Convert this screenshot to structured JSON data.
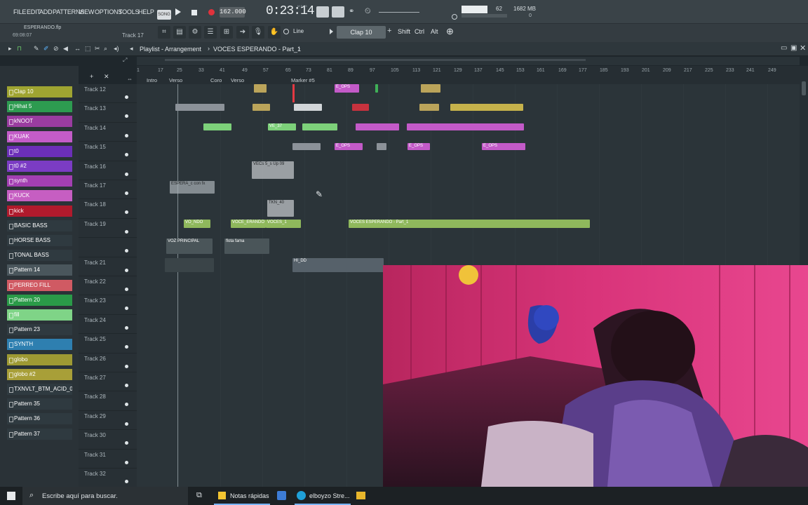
{
  "menu": [
    "FILE",
    "EDIT",
    "ADD",
    "PATTERNS",
    "VIEW",
    "OPTIONS",
    "TOOLS",
    "HELP"
  ],
  "file": {
    "name": "ESPERANDO.flp",
    "time": "69:08:07"
  },
  "transport": {
    "tempo": "162.000",
    "time": "0:23:14",
    "time_unit": "M:S:CS",
    "cpu": "62",
    "memory": "1682 MB",
    "status_values": [
      "0",
      "0"
    ]
  },
  "hint": {
    "track": "Track 17"
  },
  "toolbar": {
    "snap": "Line",
    "pattern": "Clap 10",
    "mod_keys": [
      "Shift",
      "Ctrl",
      "Alt"
    ]
  },
  "playlist": {
    "title": "Playlist - Arrangement",
    "pattern": "VOCES ESPERANDO - Part_1"
  },
  "ruler": {
    "ticks": [
      "1",
      "17",
      "25",
      "33",
      "41",
      "49",
      "57",
      "65",
      "73",
      "81",
      "89",
      "97",
      "105",
      "113",
      "121",
      "129",
      "137",
      "145",
      "153",
      "161",
      "169",
      "177",
      "185",
      "193",
      "201",
      "209",
      "217",
      "225",
      "233",
      "241",
      "249"
    ],
    "markers": [
      "Intro",
      "Verso",
      "Coro",
      "Verso",
      "Marker #5"
    ]
  },
  "channels": [
    {
      "name": "Clap 10",
      "color": "#9fa431"
    },
    {
      "name": "Hihat 5",
      "color": "#2d9b50"
    },
    {
      "name": "kNOOT",
      "color": "#9a3ca0"
    },
    {
      "name": "KUAK",
      "color": "#c35cc8"
    },
    {
      "name": "t0",
      "color": "#6b2fb8"
    },
    {
      "name": "t0 #2",
      "color": "#7b3cc4"
    },
    {
      "name": "synth",
      "color": "#a33fb2"
    },
    {
      "name": "KUCK",
      "color": "#c65ec2"
    },
    {
      "name": "kick",
      "color": "#b01a2c"
    },
    {
      "name": "BASIC BASS",
      "color": "#2f3a40"
    },
    {
      "name": "HORSE BASS",
      "color": "#2f3a40"
    },
    {
      "name": "TONAL BASS",
      "color": "#2f3a40"
    },
    {
      "name": "Pattern 14",
      "color": "#4a565c"
    },
    {
      "name": "PERREO FILL",
      "color": "#d05a63"
    },
    {
      "name": "Pattern 20",
      "color": "#2a9a48"
    },
    {
      "name": "fill",
      "color": "#7fd487"
    },
    {
      "name": "Pattern 23",
      "color": "#2f3a40"
    },
    {
      "name": "SYNTH",
      "color": "#2e7fb0"
    },
    {
      "name": "globo",
      "color": "#9e9a33"
    },
    {
      "name": "globo #2",
      "color": "#a89f38"
    },
    {
      "name": "TXNVLT_BTM_ACID_07(E)",
      "color": "#2f3a40"
    },
    {
      "name": "Pattern 35",
      "color": "#2f3a40"
    },
    {
      "name": "Pattern 36",
      "color": "#2f3a40"
    },
    {
      "name": "Pattern 37",
      "color": "#2f3a40"
    }
  ],
  "tracks": [
    "Track 12",
    "Track 13",
    "Track 14",
    "Track 15",
    "Track 16",
    "Track 17",
    "Track 18",
    "Track 19",
    "",
    "Track 21",
    "Track 22",
    "Track 23",
    "Track 24",
    "Track 25",
    "Track 26",
    "Track 27",
    "Track 28",
    "Track 29",
    "Track 30",
    "Track 31",
    "Track 32"
  ],
  "clip_labels": {
    "t12": "E_OPS",
    "t14": "VE_37",
    "t15a": "E_OPS",
    "t15b": "E_OPS",
    "t15c": "E_OPS",
    "t16": "VECs 5_s Up 09",
    "t17": "ESPERA_c con fx",
    "t18": "TKN_40",
    "t19a": "VO_NDO",
    "t19b": "VOCE_ERANDO",
    "t19c": "VOCES_1",
    "t19d": "VOCES ESPERANDO - Part_1",
    "t20a": "VOZ PRINCIPAL",
    "t20b": "flota fama",
    "t21": "HI_DD"
  },
  "taskbar": {
    "search_placeholder": "Escribe aquí para buscar.",
    "apps": [
      "Notas rápidas",
      "elboyzo Stre..."
    ]
  }
}
